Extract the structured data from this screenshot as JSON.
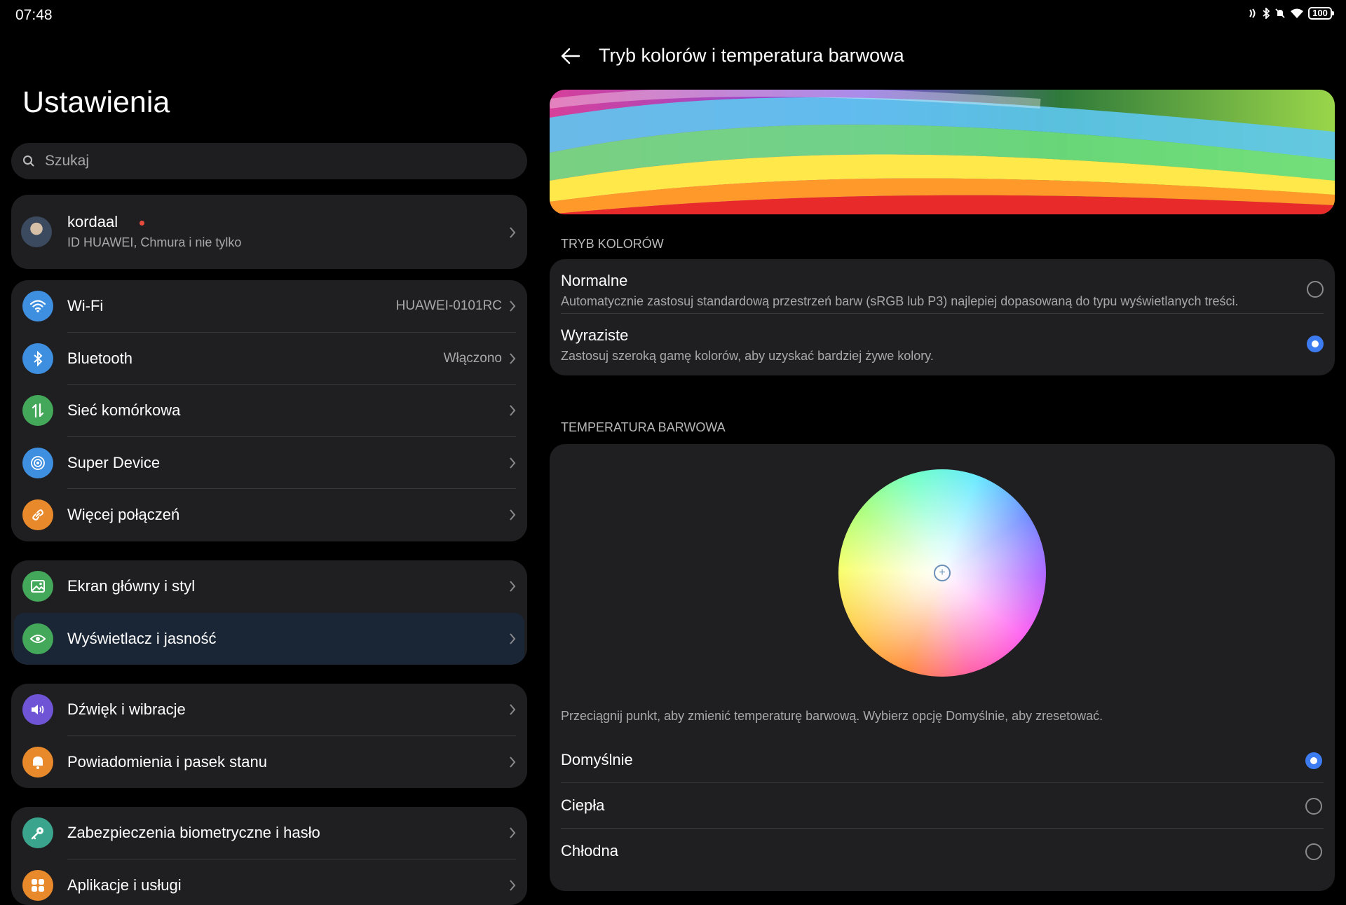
{
  "status_bar": {
    "time": "07:48",
    "battery": "100"
  },
  "left": {
    "title": "Ustawienia",
    "search_placeholder": "Szukaj",
    "account": {
      "name": "kordaal",
      "subtitle": "ID HUAWEI, Chmura i nie tylko"
    },
    "groups": [
      {
        "items": [
          {
            "label": "Wi-Fi",
            "value": "HUAWEI-0101RC",
            "icon": "wifi-icon",
            "color": "#3f8fe0"
          },
          {
            "label": "Bluetooth",
            "value": "Włączono",
            "icon": "bluetooth-icon",
            "color": "#3f8fe0"
          },
          {
            "label": "Sieć komórkowa",
            "value": "",
            "icon": "mobile-network-icon",
            "color": "#44a85a"
          },
          {
            "label": "Super Device",
            "value": "",
            "icon": "super-device-icon",
            "color": "#3f8fe0"
          },
          {
            "label": "Więcej połączeń",
            "value": "",
            "icon": "link-icon",
            "color": "#e88a2c"
          }
        ]
      },
      {
        "items": [
          {
            "label": "Ekran główny i styl",
            "value": "",
            "icon": "image-icon",
            "color": "#44a85a"
          },
          {
            "label": "Wyświetlacz i jasność",
            "value": "",
            "icon": "eye-icon",
            "color": "#44a85a"
          }
        ]
      },
      {
        "items": [
          {
            "label": "Dźwięk i wibracje",
            "value": "",
            "icon": "speaker-icon",
            "color": "#6f55d6"
          },
          {
            "label": "Powiadomienia i pasek stanu",
            "value": "",
            "icon": "bell-icon",
            "color": "#e88a2c"
          }
        ]
      },
      {
        "items": [
          {
            "label": "Zabezpieczenia biometryczne i hasło",
            "value": "",
            "icon": "key-icon",
            "color": "#3aa58c"
          },
          {
            "label": "Aplikacje i usługi",
            "value": "",
            "icon": "apps-icon",
            "color": "#e88a2c"
          }
        ]
      }
    ]
  },
  "right": {
    "title": "Tryb kolorów i temperatura barwowa",
    "color_mode": {
      "header": "TRYB KOLORÓW",
      "options": [
        {
          "title": "Normalne",
          "desc": "Automatycznie zastosuj standardową przestrzeń barw (sRGB lub P3) najlepiej dopasowaną do typu wyświetlanych treści.",
          "selected": false
        },
        {
          "title": "Wyraziste",
          "desc": "Zastosuj szeroką gamę kolorów, aby uzyskać bardziej żywe kolory.",
          "selected": true
        }
      ]
    },
    "temperature": {
      "header": "TEMPERATURA BARWOWA",
      "hint": "Przeciągnij punkt, aby zmienić temperaturę barwową. Wybierz opcję Domyślnie, aby zresetować.",
      "options": [
        {
          "label": "Domyślnie",
          "selected": true
        },
        {
          "label": "Ciepła",
          "selected": false
        },
        {
          "label": "Chłodna",
          "selected": false
        }
      ]
    }
  },
  "colors": {
    "accent": "#3d7cf0",
    "card": "#1f1f21",
    "selected_row": "#1a2636"
  }
}
